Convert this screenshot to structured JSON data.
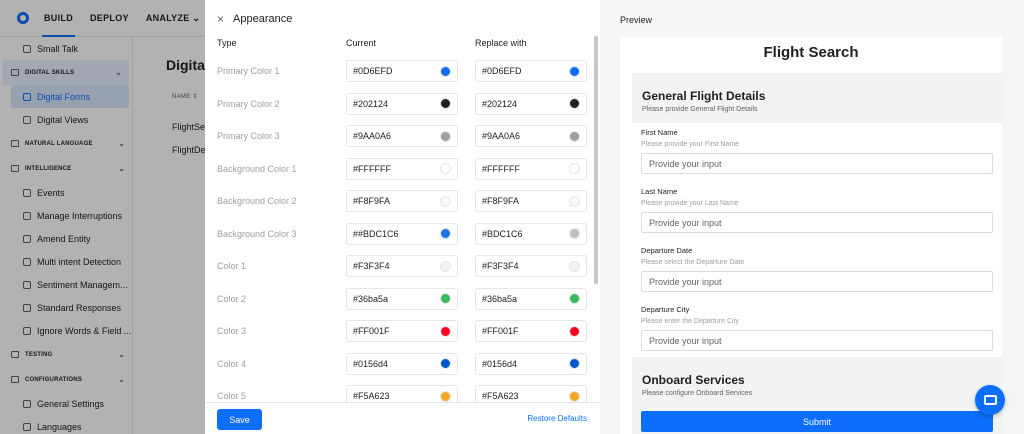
{
  "nav": {
    "tabs": [
      "BUILD",
      "DEPLOY",
      "ANALYZE"
    ],
    "analyze_chevron": "⌄"
  },
  "sidebar": {
    "items": [
      {
        "label": "Small Talk",
        "kind": "item"
      },
      {
        "label": "DIGITAL SKILLS",
        "kind": "section"
      },
      {
        "label": "Digital Forms",
        "kind": "item",
        "active": true
      },
      {
        "label": "Digital Views",
        "kind": "item"
      },
      {
        "label": "NATURAL LANGUAGE",
        "kind": "section"
      },
      {
        "label": "INTELLIGENCE",
        "kind": "section"
      },
      {
        "label": "Events",
        "kind": "item"
      },
      {
        "label": "Manage Interruptions",
        "kind": "item"
      },
      {
        "label": "Amend Entity",
        "kind": "item"
      },
      {
        "label": "Multi intent Detection",
        "kind": "item"
      },
      {
        "label": "Sentiment Managem...",
        "kind": "item"
      },
      {
        "label": "Standard Responses",
        "kind": "item"
      },
      {
        "label": "Ignore Words & Field ...",
        "kind": "item"
      },
      {
        "label": "TESTING",
        "kind": "section"
      },
      {
        "label": "CONFIGURATIONS",
        "kind": "section"
      },
      {
        "label": "General Settings",
        "kind": "item"
      },
      {
        "label": "Languages",
        "kind": "item"
      }
    ]
  },
  "main": {
    "title": "Digital",
    "column_header": "NAME ⇕",
    "rows": [
      "FlightSe",
      "FlightDe"
    ]
  },
  "panel": {
    "title": "Appearance",
    "close_icon": "×",
    "headers": {
      "type": "Type",
      "current": "Current",
      "replace": "Replace with"
    },
    "rows": [
      {
        "type": "Primary Color 1",
        "current": "#0D6EFD",
        "current_swatch": "#0d6efd",
        "replace": "#0D6EFD",
        "replace_swatch": "#0d6efd"
      },
      {
        "type": "Primary Color 2",
        "current": "#202124",
        "current_swatch": "#202124",
        "replace": "#202124",
        "replace_swatch": "#202124"
      },
      {
        "type": "Primary Color 3",
        "current": "#9AA0A6",
        "current_swatch": "#9aa0a6",
        "replace": "#9AA0A6",
        "replace_swatch": "#9aa0a6"
      },
      {
        "type": "Background Color 1",
        "current": "#FFFFFF",
        "current_swatch": "#ffffff",
        "replace": "#FFFFFF",
        "replace_swatch": "#ffffff"
      },
      {
        "type": "Background Color 2",
        "current": "#F8F9FA",
        "current_swatch": "#f8f9fa",
        "replace": "#F8F9FA",
        "replace_swatch": "#f8f9fa"
      },
      {
        "type": "Background Color 3",
        "current": "##BDC1C6",
        "current_swatch": "#1a73e8",
        "replace": "#BDC1C6",
        "replace_swatch": "#bdc1c6"
      },
      {
        "type": "Color 1",
        "current": "#F3F3F4",
        "current_swatch": "#f3f3f4",
        "replace": "#F3F3F4",
        "replace_swatch": "#f3f3f4"
      },
      {
        "type": "Color 2",
        "current": "#36ba5a",
        "current_swatch": "#36ba5a",
        "replace": "#36ba5a",
        "replace_swatch": "#36ba5a"
      },
      {
        "type": "Color 3",
        "current": "#FF001F",
        "current_swatch": "#ff001f",
        "replace": "#FF001F",
        "replace_swatch": "#ff001f"
      },
      {
        "type": "Color 4",
        "current": "#0156d4",
        "current_swatch": "#0156d4",
        "replace": "#0156d4",
        "replace_swatch": "#0156d4"
      },
      {
        "type": "Color 5",
        "current": "#F5A623",
        "current_swatch": "#f5a623",
        "replace": "#F5A623",
        "replace_swatch": "#f5a623"
      }
    ],
    "save_label": "Save",
    "restore_label": "Restore Defaults"
  },
  "preview": {
    "label": "Preview",
    "form_title": "Flight Search",
    "sections": [
      {
        "title": "General Flight Details",
        "subtitle": "Please provide General Flight Details"
      },
      {
        "title": "Onboard Services",
        "subtitle": "Please configure Onboard Services"
      }
    ],
    "fields": [
      {
        "label": "First Name",
        "help": "Please provide your First Name",
        "placeholder": "Provide your input"
      },
      {
        "label": "Last Name",
        "help": "Please provide your Last Name",
        "placeholder": "Provide your input"
      },
      {
        "label": "Departure Date",
        "help": "Please select the Departure Date",
        "placeholder": "Provide your input"
      },
      {
        "label": "Departure City",
        "help": "Please enter the Departure City",
        "placeholder": "Provide your input"
      }
    ],
    "submit_label": "Submit"
  }
}
